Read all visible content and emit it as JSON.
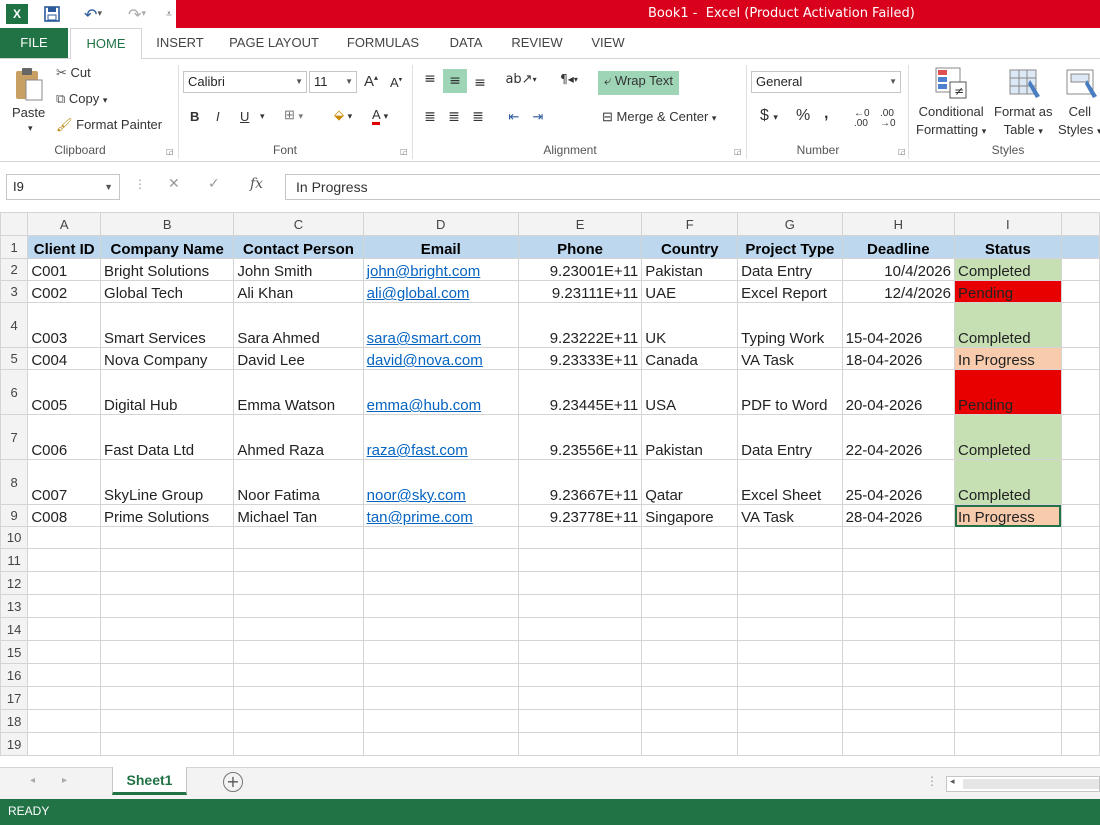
{
  "window": {
    "title": "Book1 -  Excel (Product Activation Failed)"
  },
  "ribbon_tabs": [
    "FILE",
    "HOME",
    "INSERT",
    "PAGE LAYOUT",
    "FORMULAS",
    "DATA",
    "REVIEW",
    "VIEW"
  ],
  "clipboard": {
    "paste": "Paste",
    "cut": "Cut",
    "copy": "Copy",
    "format_painter": "Format Painter",
    "label": "Clipboard"
  },
  "font": {
    "family": "Calibri",
    "size": "11",
    "bold": "B",
    "italic": "I",
    "underline": "U",
    "label": "Font"
  },
  "alignment": {
    "wrap_text": "Wrap Text",
    "merge_center": "Merge & Center",
    "label": "Alignment"
  },
  "number": {
    "format": "General",
    "currency": "$",
    "percent": "%",
    "comma": ",",
    "label": "Number"
  },
  "styles": {
    "conditional": "Conditional",
    "formatting": "Formatting",
    "format_as": "Format as",
    "table": "Table",
    "cell": "Cell",
    "cell_styles": "Styles",
    "label": "Styles"
  },
  "formula_bar": {
    "name_box": "I9",
    "fx": "fx",
    "value": "In Progress"
  },
  "columns": [
    "A",
    "B",
    "C",
    "D",
    "E",
    "F",
    "G",
    "H",
    "I"
  ],
  "headers": [
    "Client ID",
    "Company Name",
    "Contact Person",
    "Email",
    "Phone",
    "Country",
    "Project Type",
    "Deadline",
    "Status"
  ],
  "rows": [
    {
      "id": "C001",
      "company": "Bright Solutions",
      "contact": "John Smith",
      "email": "john@bright.com",
      "phone": "9.23001E+11",
      "country": "Pakistan",
      "project": "Data Entry",
      "deadline": "10/4/2026",
      "status": "Completed"
    },
    {
      "id": "C002",
      "company": "Global Tech",
      "contact": "Ali Khan",
      "email": "ali@global.com",
      "phone": "9.23111E+11",
      "country": "UAE",
      "project": "Excel Report",
      "deadline": "12/4/2026",
      "status": "Pending"
    },
    {
      "id": "C003",
      "company": "Smart Services",
      "contact": "Sara Ahmed",
      "email": "sara@smart.com",
      "phone": "9.23222E+11",
      "country": "UK",
      "project": "Typing Work",
      "deadline": "15-04-2026",
      "status": "Completed"
    },
    {
      "id": "C004",
      "company": "Nova Company",
      "contact": "David Lee",
      "email": "david@nova.com",
      "phone": "9.23333E+11",
      "country": "Canada",
      "project": "VA Task",
      "deadline": "18-04-2026",
      "status": "In Progress"
    },
    {
      "id": "C005",
      "company": "Digital Hub",
      "contact": "Emma Watson",
      "email": "emma@hub.com",
      "phone": "9.23445E+11",
      "country": "USA",
      "project": "PDF to Word",
      "deadline": "20-04-2026",
      "status": "Pending"
    },
    {
      "id": "C006",
      "company": "Fast Data Ltd",
      "contact": "Ahmed Raza",
      "email": "raza@fast.com",
      "phone": "9.23556E+11",
      "country": "Pakistan",
      "project": "Data Entry",
      "deadline": "22-04-2026",
      "status": "Completed"
    },
    {
      "id": "C007",
      "company": "SkyLine Group",
      "contact": "Noor Fatima",
      "email": "noor@sky.com",
      "phone": "9.23667E+11",
      "country": "Qatar",
      "project": "Excel Sheet",
      "deadline": "25-04-2026",
      "status": "Completed"
    },
    {
      "id": "C008",
      "company": "Prime Solutions",
      "contact": "Michael Tan",
      "email": "tan@prime.com",
      "phone": "9.23778E+11",
      "country": "Singapore",
      "project": "VA Task",
      "deadline": "28-04-2026",
      "status": "In Progress"
    }
  ],
  "row_numbers": [
    "1",
    "2",
    "3",
    "4",
    "5",
    "6",
    "7",
    "8",
    "9",
    "10",
    "11",
    "12",
    "13",
    "14",
    "15",
    "16",
    "17",
    "18",
    "19"
  ],
  "status_colors": {
    "Completed": "#c6e0b4",
    "Pending": "#e80000",
    "In Progress": "#f8cbad"
  },
  "sheet_tab": "Sheet1",
  "status_bar": "READY"
}
